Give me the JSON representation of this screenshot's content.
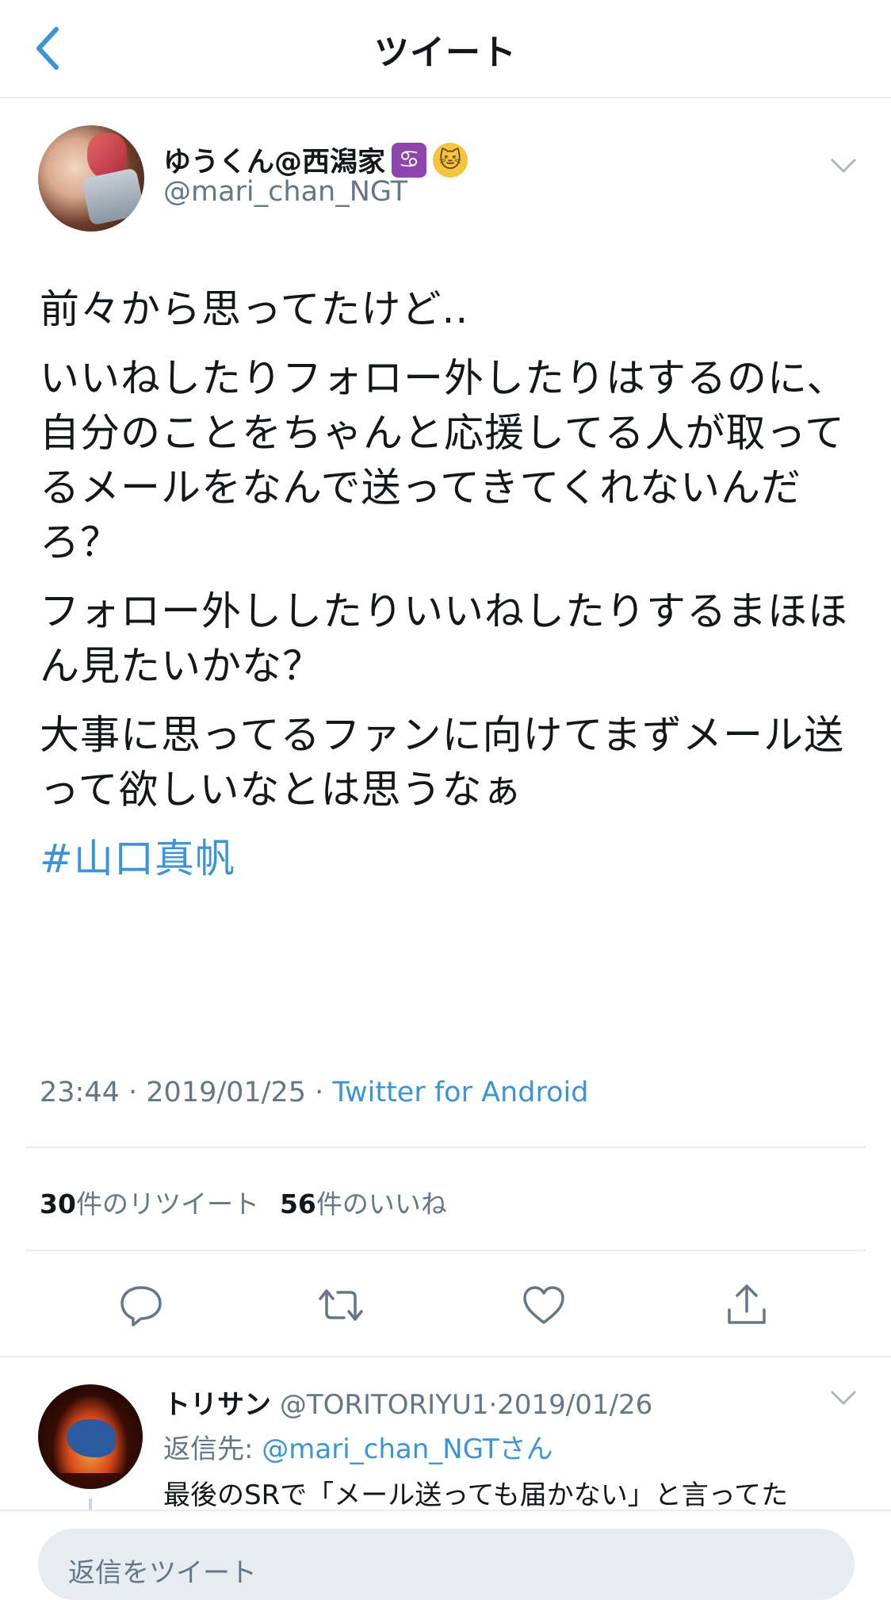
{
  "nav": {
    "title": "ツイート",
    "back_icon": "chevron-left-icon"
  },
  "tweet": {
    "display_name": "ゆうくん@西潟家",
    "name_emojis": [
      "♋",
      "🐱"
    ],
    "handle": "@mari_chan_NGT",
    "paragraphs": [
      "前々から思ってたけど..",
      "いいねしたりフォロー外したりはするのに、自分のことをちゃんと応援してる人が取ってるメールをなんで送ってきてくれないんだろ？",
      "フォロー外ししたりいいねしたりするまほほん見たいかな？",
      "大事に思ってるファンに向けてまずメール送って欲しいなとは思うなぁ"
    ],
    "hashtag": "#山口真帆",
    "time": "23:44",
    "date": "2019/01/25",
    "source": "Twitter for Android",
    "retweet_count": "30",
    "retweet_label": "件のリツイート",
    "like_count": "56",
    "like_label": "件のいいね"
  },
  "actions": [
    "reply-icon",
    "retweet-icon",
    "like-icon",
    "share-icon"
  ],
  "reply": {
    "display_name": "トリサン",
    "handle": "@TORITORIYU1",
    "date": "2019/01/26",
    "reply_to_label": "返信先: ",
    "reply_to_handle": "@mari_chan_NGTさん",
    "body": "最後のSRで「メール送っても届かない」と言ってた"
  },
  "composer": {
    "placeholder": "返信をツイート"
  },
  "colors": {
    "accent": "#3b94d9",
    "muted": "#657786",
    "text": "#14171a",
    "divider": "#e6ecf0"
  }
}
